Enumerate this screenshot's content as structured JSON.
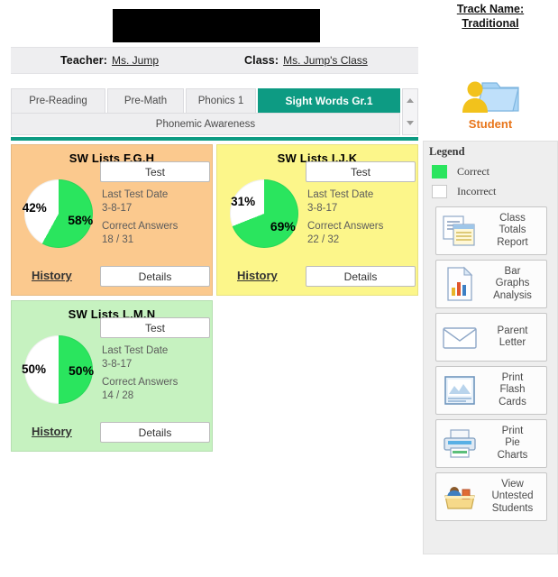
{
  "header": {
    "redacted_bar": "",
    "teacher_label": "Teacher:",
    "teacher_value": "Ms. Jump",
    "class_label": "Class:",
    "class_value": "Ms. Jump's Class",
    "track_name_label": "Track Name:",
    "track_name_value": "Traditional",
    "student_label": "Student"
  },
  "tabs": [
    {
      "label": "Pre-Reading",
      "active": false
    },
    {
      "label": "Pre-Math",
      "active": false
    },
    {
      "label": "Phonics 1",
      "active": false
    },
    {
      "label": "Sight Words Gr.1",
      "active": true
    },
    {
      "label": "Phonemic Awareness",
      "active": false
    }
  ],
  "cards": [
    {
      "title": "SW Lists F,G,H",
      "bg": "#fbc98e",
      "test_label": "Test",
      "incorrect_pct": "42%",
      "correct_pct": "58%",
      "correct_value": 58,
      "incorrect_value": 42,
      "last_test_date_label": "Last Test Date",
      "last_test_date": "3-8-17",
      "correct_answers_label": "Correct Answers",
      "correct_answers": "18 / 31",
      "history_label": "History",
      "details_label": "Details"
    },
    {
      "title": "SW Lists I,J,K",
      "bg": "#fcf68a",
      "test_label": "Test",
      "incorrect_pct": "31%",
      "correct_pct": "69%",
      "correct_value": 69,
      "incorrect_value": 31,
      "last_test_date_label": "Last Test Date",
      "last_test_date": "3-8-17",
      "correct_answers_label": "Correct Answers",
      "correct_answers": "22 / 32",
      "history_label": "History",
      "details_label": "Details"
    },
    {
      "title": "SW Lists L,M,N",
      "bg": "#c6f2c0",
      "test_label": "Test",
      "incorrect_pct": "50%",
      "correct_pct": "50%",
      "correct_value": 50,
      "incorrect_value": 50,
      "last_test_date_label": "Last Test Date",
      "last_test_date": "3-8-17",
      "correct_answers_label": "Correct Answers",
      "correct_answers": "14 / 28",
      "history_label": "History",
      "details_label": "Details"
    }
  ],
  "legend": {
    "title": "Legend",
    "correct_label": "Correct",
    "incorrect_label": "Incorrect",
    "correct_color": "#2ae55e",
    "incorrect_color": "#ffffff"
  },
  "side_buttons": [
    {
      "label": "Class\nTotals\nReport",
      "icon": "class-totals-report-icon"
    },
    {
      "label": "Bar\nGraphs\nAnalysis",
      "icon": "bar-graphs-analysis-icon"
    },
    {
      "label": "Parent\nLetter",
      "icon": "envelope-icon"
    },
    {
      "label": "Print\nFlash\nCards",
      "icon": "flash-cards-icon"
    },
    {
      "label": "Print\nPie\nCharts",
      "icon": "printer-icon"
    },
    {
      "label": "View\nUntested\nStudents",
      "icon": "untested-students-icon"
    }
  ],
  "colors": {
    "accent_teal": "#0d9b83",
    "pie_green": "#2ae55e",
    "student_orange": "#e8751a"
  },
  "chart_data": [
    {
      "type": "pie",
      "title": "SW Lists F,G,H",
      "categories": [
        "Correct",
        "Incorrect"
      ],
      "values": [
        58,
        42
      ],
      "labels": [
        "58%",
        "42%"
      ],
      "colors": [
        "#2ae55e",
        "#ffffff"
      ],
      "annotations": [
        "Last Test Date 3-8-17",
        "Correct Answers 18 / 31"
      ]
    },
    {
      "type": "pie",
      "title": "SW Lists I,J,K",
      "categories": [
        "Correct",
        "Incorrect"
      ],
      "values": [
        69,
        31
      ],
      "labels": [
        "69%",
        "31%"
      ],
      "colors": [
        "#2ae55e",
        "#ffffff"
      ],
      "annotations": [
        "Last Test Date 3-8-17",
        "Correct Answers 22 / 32"
      ]
    },
    {
      "type": "pie",
      "title": "SW Lists L,M,N",
      "categories": [
        "Correct",
        "Incorrect"
      ],
      "values": [
        50,
        50
      ],
      "labels": [
        "50%",
        "50%"
      ],
      "colors": [
        "#2ae55e",
        "#ffffff"
      ],
      "annotations": [
        "Last Test Date 3-8-17",
        "Correct Answers 14 / 28"
      ]
    }
  ]
}
